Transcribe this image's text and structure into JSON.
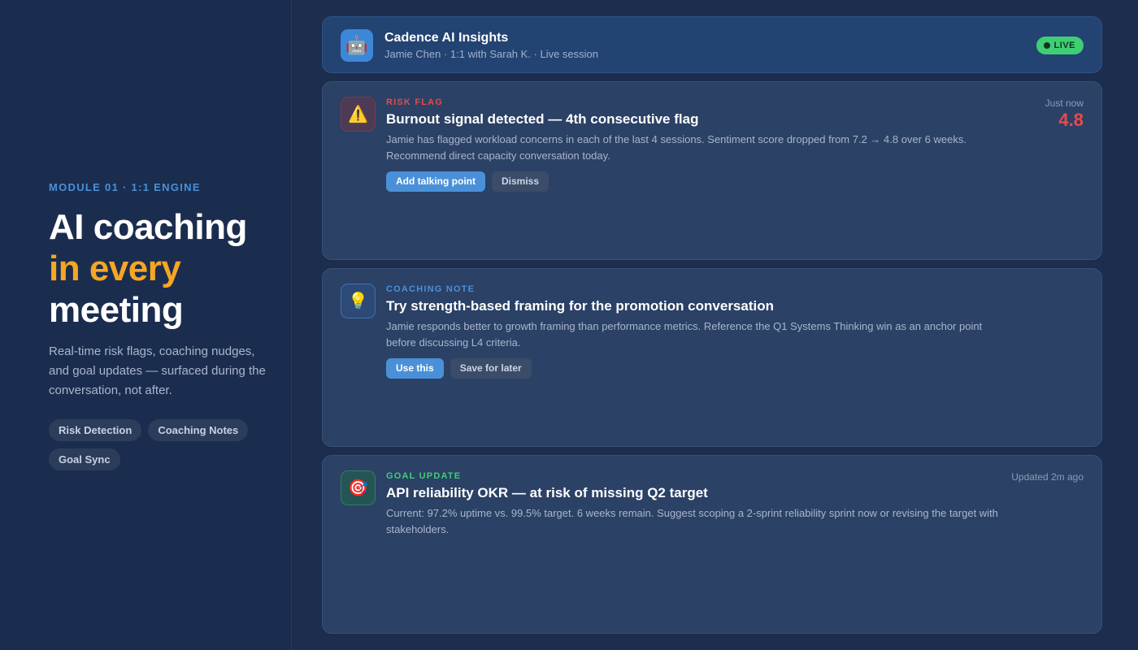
{
  "left": {
    "eyebrow": "MODULE 01 · 1:1 ENGINE",
    "headline_line1": "AI coaching",
    "headline_accent": "in every",
    "headline_line3": "meeting",
    "lede": "Real-time risk flags, coaching nudges, and goal updates — surfaced during the conversation, not after.",
    "tags": [
      "Risk Detection",
      "Coaching Notes",
      "Goal Sync"
    ]
  },
  "header": {
    "icon": "robot-icon",
    "title": "Cadence AI Insights",
    "subtitle": "Jamie Chen · 1:1 with Sarah K. · Live session",
    "live_label": "LIVE"
  },
  "cards": [
    {
      "icon": "warning-icon",
      "kicker": "RISK FLAG",
      "kicker_color": "#e84a4a",
      "title": "Burnout signal detected — 4th consecutive flag",
      "body": "Jamie has flagged workload concerns in each of the last 4 sessions. Sentiment score dropped from 7.2 → 4.8 over 6 weeks. Recommend direct capacity conversation today.",
      "meta": "Just now",
      "score": "4.8",
      "primary_action": "Add talking point",
      "secondary_action": "Dismiss"
    },
    {
      "icon": "lightbulb-icon",
      "kicker": "COACHING NOTE",
      "kicker_color": "#4a90d9",
      "title": "Try strength-based framing for the promotion conversation",
      "body": "Jamie responds better to growth framing than performance metrics. Reference the Q1 Systems Thinking win as an anchor point before discussing L4 criteria.",
      "primary_action": "Use this",
      "secondary_action": "Save for later"
    },
    {
      "icon": "target-icon",
      "kicker": "GOAL UPDATE",
      "kicker_color": "#3ecf74",
      "title": "API reliability OKR — at risk of missing Q2 target",
      "body": "Current: 97.2% uptime vs. 99.5% target. 6 weeks remain. Suggest scoping a 2-sprint reliability sprint now or revising the target with stakeholders.",
      "meta": "Updated 2m ago"
    }
  ]
}
